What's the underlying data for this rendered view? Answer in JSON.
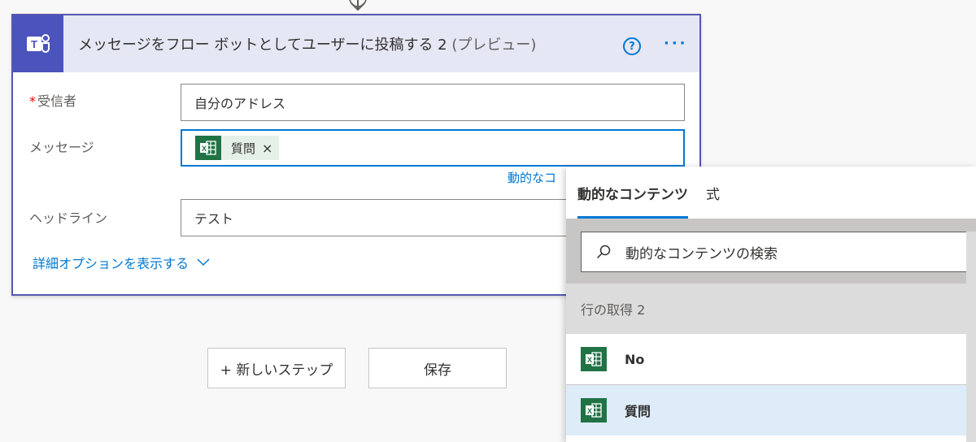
{
  "card": {
    "title": "メッセージをフロー ボットとしてユーザーに投稿する 2",
    "title_suffix": "(プレビュー)",
    "help_icon_text": "?",
    "more_icon_text": "···",
    "recipient": {
      "required_mark": "*",
      "label": "受信者",
      "value": "自分のアドレス"
    },
    "message": {
      "label": "メッセージ",
      "token": "質問",
      "token_remove": "×"
    },
    "dynamic_link": "動的なコ",
    "headline": {
      "label": "ヘッドライン",
      "value": "テスト"
    },
    "advanced_options": "詳細オプションを表示する"
  },
  "buttons": {
    "new_step": "+ 新しいステップ",
    "save": "保存"
  },
  "panel": {
    "tabs": [
      "動的なコンテンツ",
      "式"
    ],
    "active_tab": 0,
    "search_placeholder": "動的なコンテンツの検索",
    "group_header": "行の取得 2",
    "items": [
      {
        "label": "No"
      },
      {
        "label": "質問",
        "selected": true
      }
    ]
  },
  "colors": {
    "accent": "#0078d4",
    "card_border": "#5558af",
    "header_bg": "#e6e7f4",
    "teams": "#4b53bc",
    "excel": "#217346",
    "token_bg": "#e5f1e8",
    "selected_bg": "#deecf9"
  },
  "icons": [
    "teams-icon",
    "help-icon",
    "more-icon",
    "excel-icon",
    "search-icon",
    "chevron-down-icon",
    "arrow-down-icon",
    "close-icon"
  ]
}
